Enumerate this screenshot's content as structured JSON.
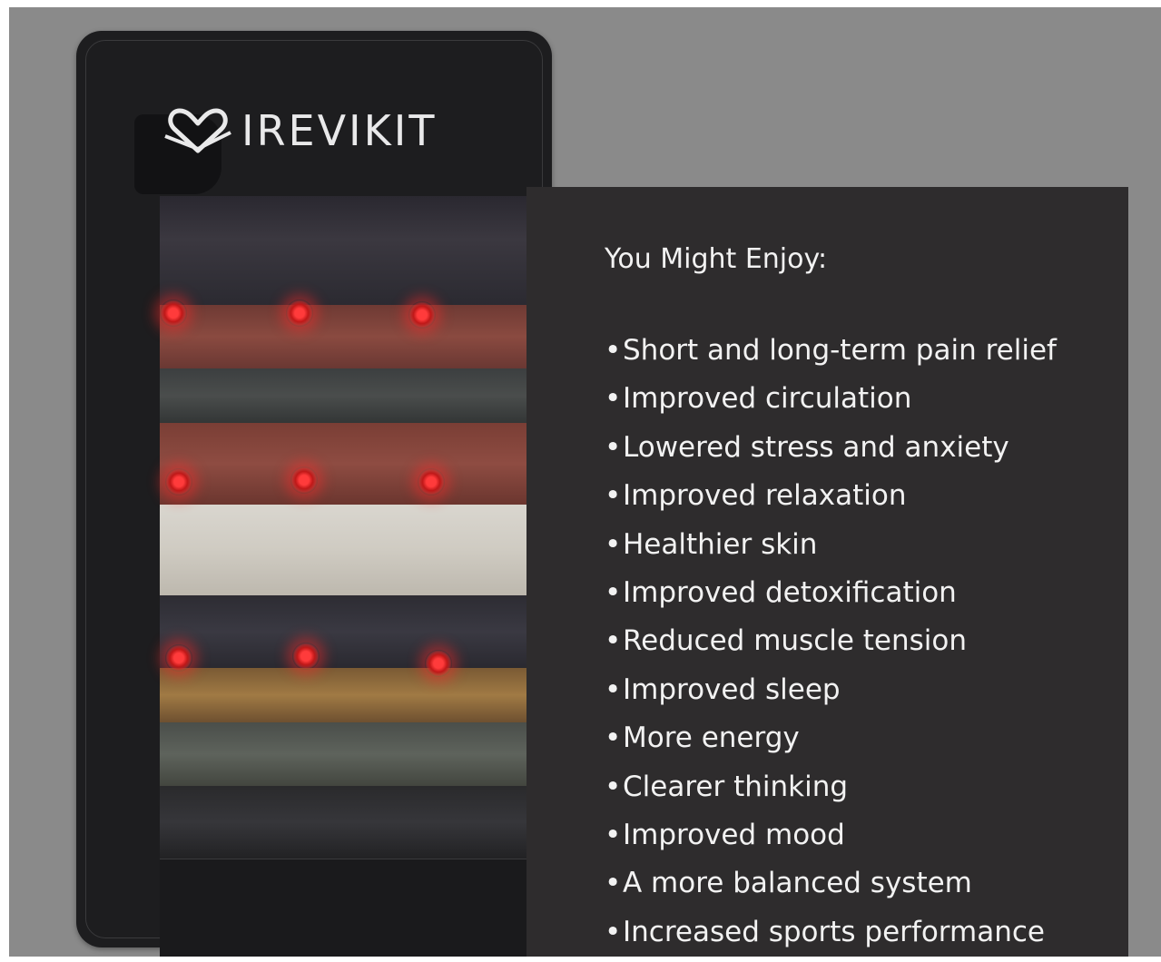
{
  "brand": {
    "logo_text": "IREVIKIT"
  },
  "product_image": {
    "subject": "mat-photo",
    "led_count": 9
  },
  "panel": {
    "heading": "You Might Enjoy:",
    "bullet": "•",
    "benefits": [
      "Short and long-term pain relief",
      "Improved circulation",
      "Lowered stress and anxiety",
      "Improved relaxation",
      "Healthier skin",
      "Improved detoxification",
      "Reduced muscle tension",
      "Improved sleep",
      "More energy",
      "Clearer thinking",
      "Improved mood",
      "A more balanced system",
      "Increased sports performance"
    ]
  },
  "colors": {
    "background": "#8a8a8a",
    "panel": "#2e2c2d",
    "text": "#f2f2f2",
    "led": "#ff3b3b"
  },
  "icons": [
    "heart-logo-icon"
  ]
}
